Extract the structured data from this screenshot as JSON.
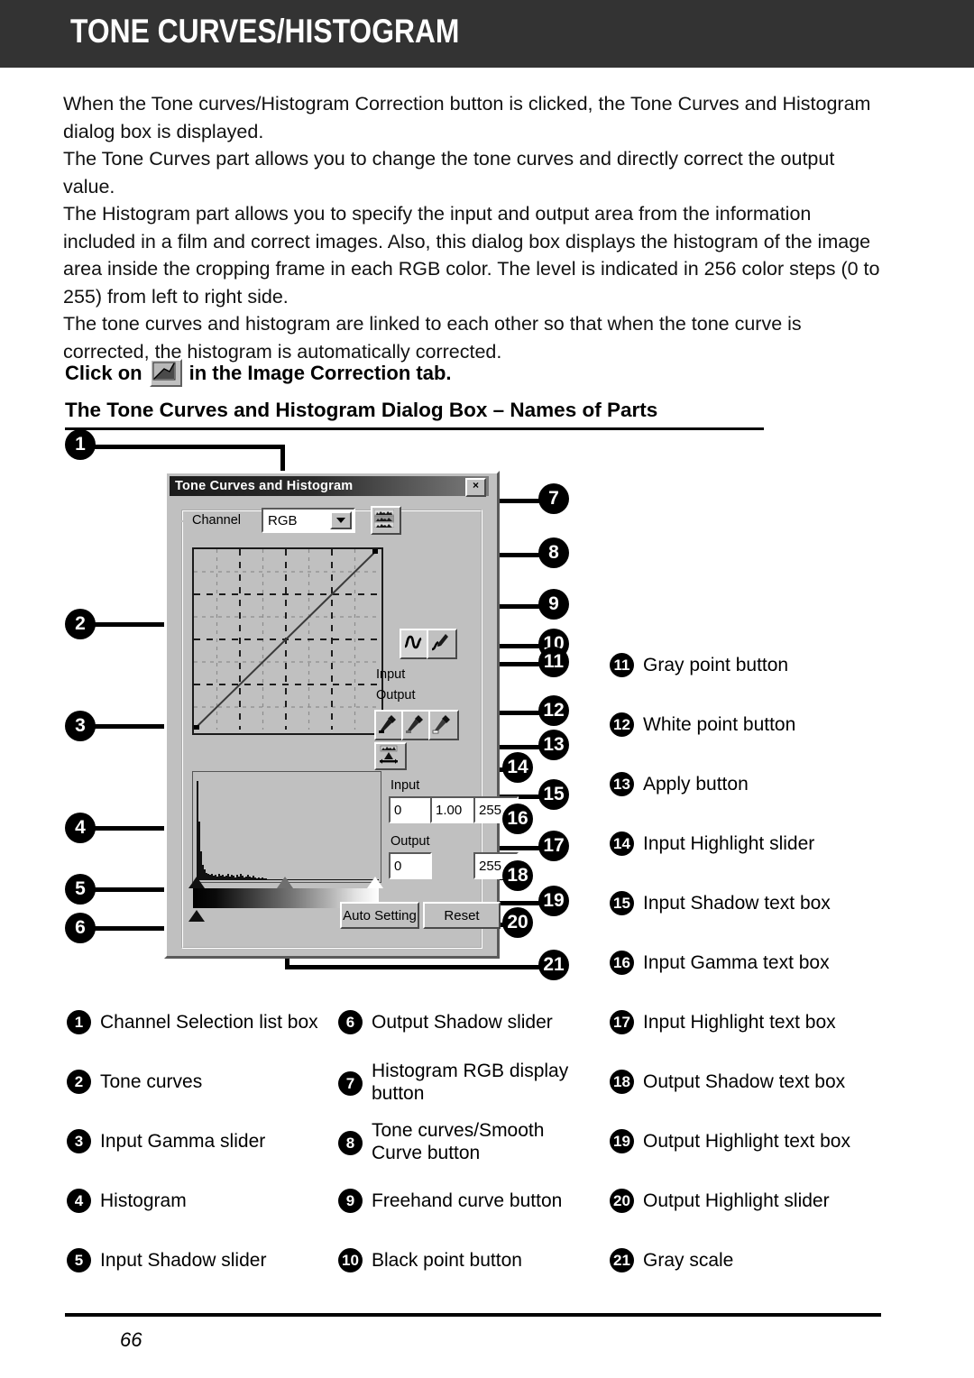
{
  "header": {
    "title": "TONE CURVES/HISTOGRAM"
  },
  "intro": {
    "p1": "When the Tone curves/Histogram Correction button is clicked, the Tone Curves and Histogram dialog box is displayed.",
    "p2": "The Tone Curves part allows you to change the tone curves and directly correct the output value.",
    "p3": "The Histogram part allows you to specify the input and output area from the information included in a film and correct images. Also, this dialog box displays the histogram of the image area inside the cropping frame in each RGB color. The level is indicated in 256 color steps (0 to 255) from left to right side.",
    "p4": "The tone curves and histogram are linked to each other so that when the tone curve is corrected, the histogram is automatically corrected."
  },
  "instruction": {
    "before_icon": "Click on",
    "after_icon": "in the Image Correction tab.",
    "icon_name": "tone-curve-icon"
  },
  "subheading": "The Tone Curves and Histogram Dialog Box – Names of Parts",
  "dialog": {
    "title": "Tone Curves and Histogram",
    "close_label": "×",
    "channel_label": "Channel",
    "channel_value": "RGB",
    "curve_input_label": "Input",
    "curve_output_label": "Output",
    "hist_input_label": "Input",
    "hist_output_label": "Output",
    "input_shadow_value": "0",
    "input_gamma_value": "1.00",
    "input_highlight_value": "255",
    "output_shadow_value": "0",
    "output_highlight_value": "255",
    "auto_setting_label": "Auto Setting",
    "reset_label": "Reset"
  },
  "callouts": [
    {
      "n": "1"
    },
    {
      "n": "2"
    },
    {
      "n": "3"
    },
    {
      "n": "4"
    },
    {
      "n": "5"
    },
    {
      "n": "6"
    },
    {
      "n": "7"
    },
    {
      "n": "8"
    },
    {
      "n": "9"
    },
    {
      "n": "10"
    },
    {
      "n": "11"
    },
    {
      "n": "12"
    },
    {
      "n": "13"
    },
    {
      "n": "14"
    },
    {
      "n": "15"
    },
    {
      "n": "16"
    },
    {
      "n": "17"
    },
    {
      "n": "18"
    },
    {
      "n": "19"
    },
    {
      "n": "20"
    },
    {
      "n": "21"
    }
  ],
  "side_legend": [
    {
      "num": "11",
      "text": "Gray point button"
    },
    {
      "num": "12",
      "text": "White point button"
    },
    {
      "num": "13",
      "text": "Apply button"
    },
    {
      "num": "14",
      "text": "Input Highlight slider"
    },
    {
      "num": "15",
      "text": "Input Shadow text box"
    },
    {
      "num": "16",
      "text": "Input Gamma text box"
    }
  ],
  "legend_col1": [
    {
      "num": "1",
      "text": "Channel Selection list box"
    },
    {
      "num": "2",
      "text": "Tone curves"
    },
    {
      "num": "3",
      "text": "Input Gamma slider"
    },
    {
      "num": "4",
      "text": "Histogram"
    },
    {
      "num": "5",
      "text": "Input Shadow slider"
    }
  ],
  "legend_col2": [
    {
      "num": "6",
      "text": "Output Shadow slider"
    },
    {
      "num": "7",
      "text": "Histogram RGB display button"
    },
    {
      "num": "8",
      "text": "Tone curves/Smooth Curve button"
    },
    {
      "num": "9",
      "text": "Freehand curve button"
    },
    {
      "num": "10",
      "text": "Black point button"
    }
  ],
  "legend_col3": [
    {
      "num": "17",
      "text": "Input Highlight text box"
    },
    {
      "num": "18",
      "text": "Output Shadow text box"
    },
    {
      "num": "19",
      "text": "Output Highlight text box"
    },
    {
      "num": "20",
      "text": "Output Highlight slider"
    },
    {
      "num": "21",
      "text": "Gray scale"
    }
  ],
  "footer": {
    "page_number": "66"
  },
  "colors": {
    "header_bg": "#333333",
    "dialog_face": "#c0c0c0",
    "titlebar": "#1c1c1c",
    "ink": "#000000"
  }
}
